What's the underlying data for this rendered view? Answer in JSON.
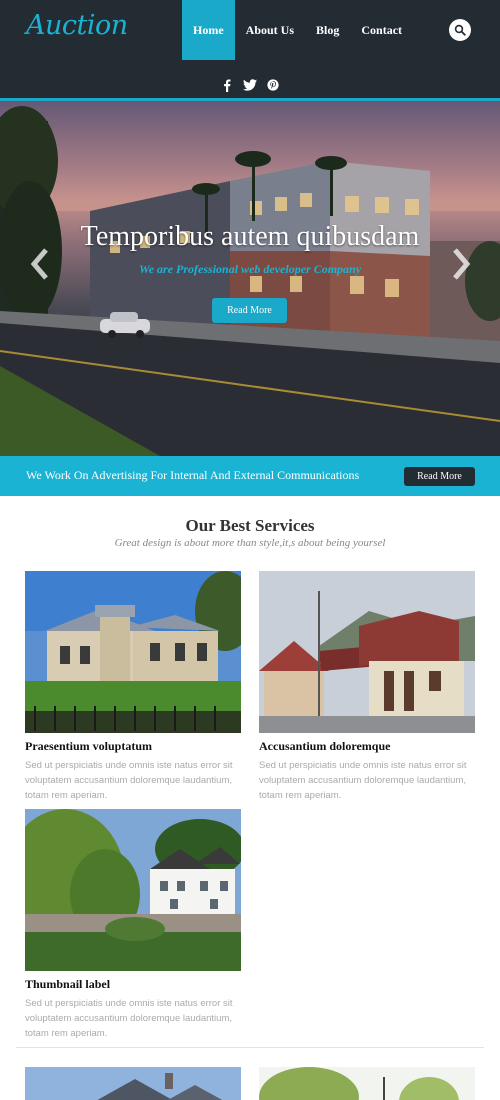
{
  "header": {
    "logo": "Auction",
    "nav": [
      {
        "label": "Home",
        "active": true
      },
      {
        "label": "About Us",
        "active": false
      },
      {
        "label": "Blog",
        "active": false
      },
      {
        "label": "Contact",
        "active": false
      }
    ],
    "search_icon": "search-icon",
    "social_icons": [
      "facebook-icon",
      "twitter-icon",
      "pinterest-icon"
    ]
  },
  "hero": {
    "title": "Temporibus autem quibusdam",
    "subtitle": "We are Professional web developer Company",
    "button": "Read More"
  },
  "banner": {
    "text": "We Work On Advertising For Internal And External Communications",
    "button": "Read More"
  },
  "services": {
    "title": "Our Best Services",
    "subtitle": "Great design is about more than style,it,s about being yoursel",
    "cards": [
      {
        "title": "Praesentium voluptatum",
        "text": "Sed ut perspiciatis unde omnis iste natus error sit voluptatem accusantium doloremque laudantium, totam rem aperiam."
      },
      {
        "title": "Accusantium doloremque",
        "text": "Sed ut perspiciatis unde omnis iste natus error sit voluptatem accusantium doloremque laudantium, totam rem aperiam."
      },
      {
        "title": "Thumbnail label",
        "text": "Sed ut perspiciatis unde omnis iste natus error sit voluptatem accusantium doloremque laudantium, totam rem aperiam."
      }
    ]
  },
  "colors": {
    "accent": "#1aa9c9",
    "header_bg": "#232b33",
    "banner_bg": "#1ab3d4"
  }
}
